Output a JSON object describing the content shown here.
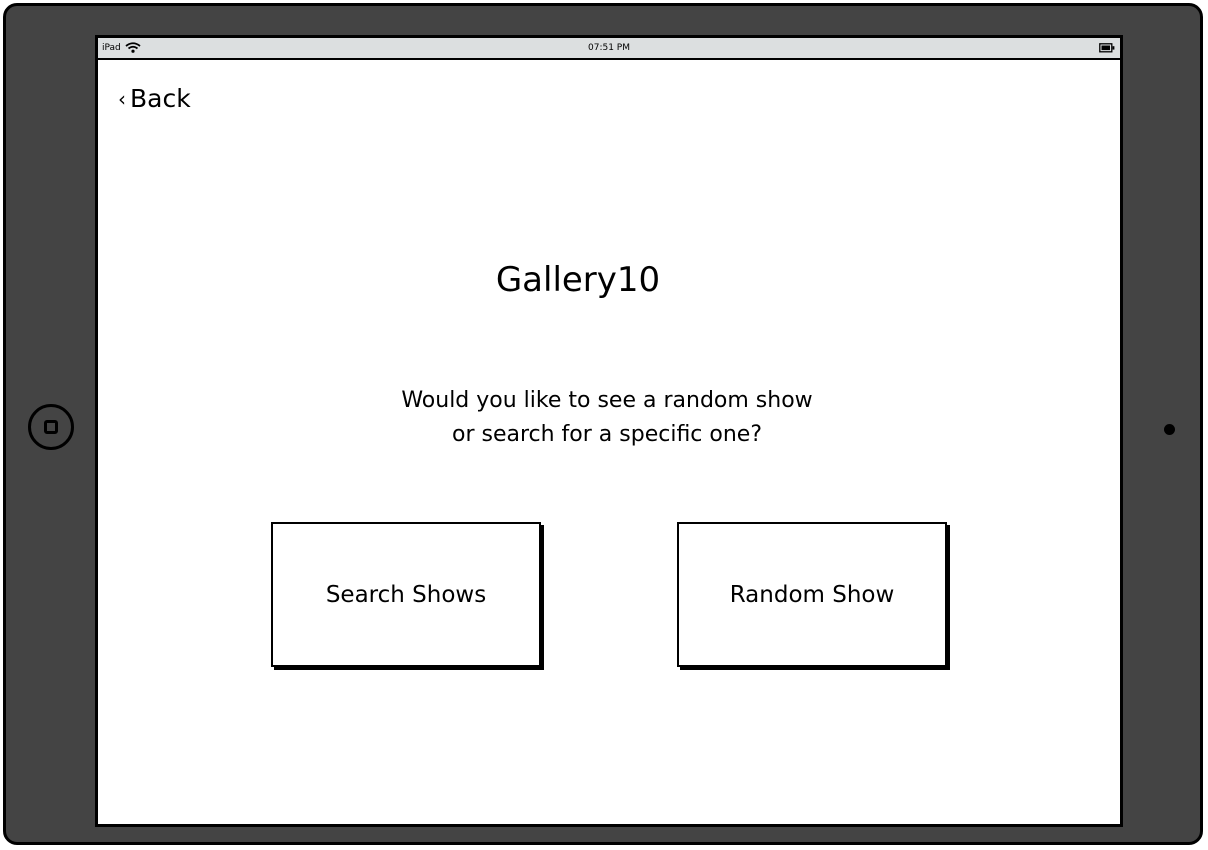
{
  "status_bar": {
    "device": "iPad",
    "time": "07:51 PM",
    "wifi_icon": "wifi-icon",
    "battery_icon": "battery-icon"
  },
  "nav": {
    "back_label": "Back",
    "back_icon": "chevron-left-icon"
  },
  "main": {
    "title": "Gallery10",
    "question_line1": "Would you like to see a random show",
    "question_line2": "or search for a specific one?"
  },
  "actions": {
    "search_label": "Search Shows",
    "random_label": "Random Show"
  },
  "device": {
    "home_button_icon": "home-button-icon",
    "camera_icon": "camera-icon"
  },
  "colors": {
    "frame": "#444444",
    "status_bar": "#dcdfe0",
    "screen": "#ffffff"
  }
}
